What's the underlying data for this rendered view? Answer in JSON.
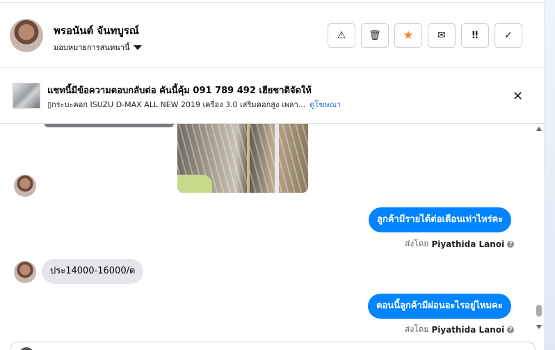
{
  "header": {
    "contact_name": "พรอนันต์ จันทบูรณ์",
    "subtitle": "มอบหมายการสนทนานี้",
    "actions": [
      {
        "name": "mark-spam-button",
        "glyph": "⚠"
      },
      {
        "name": "delete-button",
        "glyph": "🗑"
      },
      {
        "name": "star-button",
        "glyph": "★"
      },
      {
        "name": "mark-unread-button",
        "glyph": "✉"
      },
      {
        "name": "follow-up-button",
        "glyph": "‼"
      },
      {
        "name": "mark-done-button",
        "glyph": "✓"
      }
    ]
  },
  "ad": {
    "title": "แชทนี้มีข้อความตอบกลับต่อ คันนี้คุ้ม 091 789 492 เฮียชาติจัดให้",
    "subtitle": "▯กระบะคอก ISUZU D-MAX ALL NEW 2019 เครื่อง 3.0 เสริมคอกสูง เพลา...",
    "link": "ดูโฆษณา",
    "close": "✕"
  },
  "messages": {
    "out1": "ลูกค้ามีรายได้ต่อเดือนเท่าไหร่คะ",
    "in1": "ประ14000-16000/ด",
    "out2": "ตอนนี้ลูกค้ามีผ่อนอะไรอยู่ไหมคะ",
    "sent_by_label": "ส่งโดย",
    "sender": "Piyathida Lanoi",
    "info_glyph": "?"
  },
  "colors": {
    "accent": "#0084ff",
    "star": "#f08a24",
    "link": "#216fdb"
  }
}
